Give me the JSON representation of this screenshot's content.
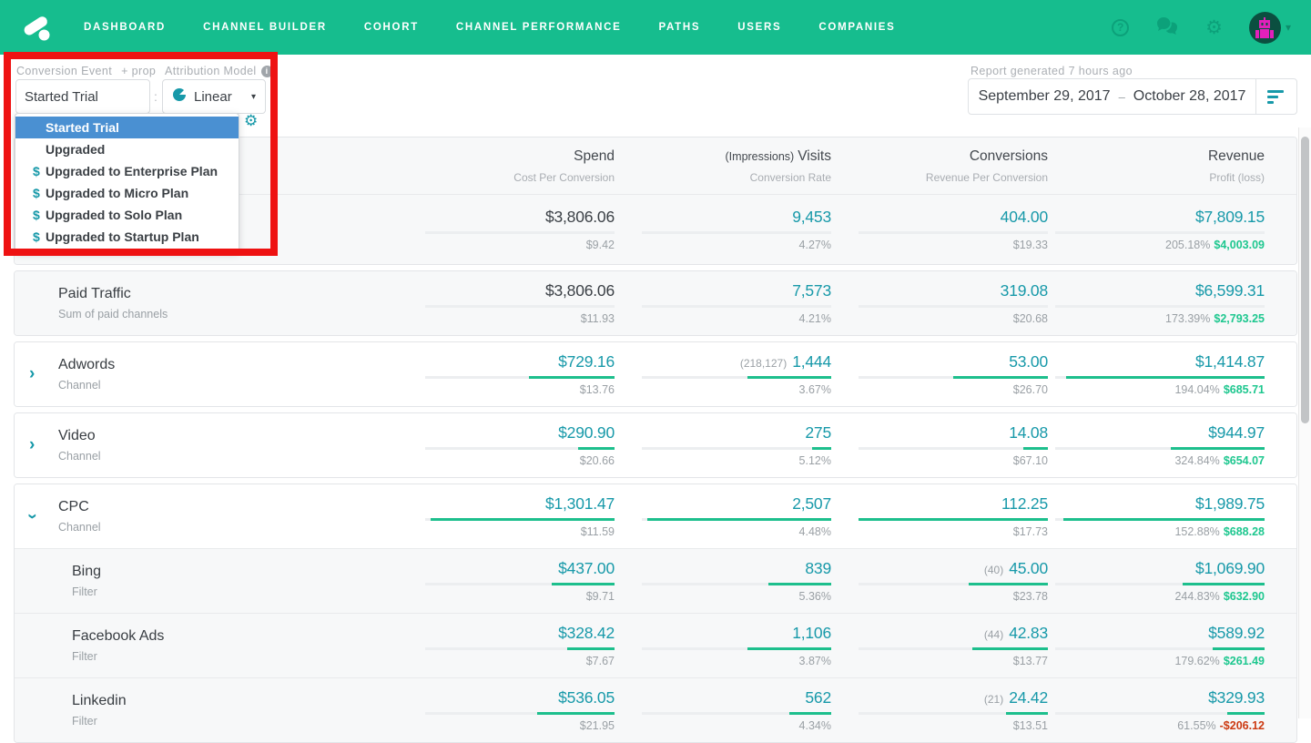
{
  "nav": {
    "items": [
      {
        "label": "DASHBOARD"
      },
      {
        "label": "CHANNEL BUILDER"
      },
      {
        "label": "COHORT"
      },
      {
        "label": "CHANNEL PERFORMANCE"
      },
      {
        "label": "PATHS"
      },
      {
        "label": "USERS"
      },
      {
        "label": "COMPANIES"
      }
    ]
  },
  "icons": {
    "help": "?",
    "gear": "⚙",
    "user_caret": "▾",
    "select_caret": "▾",
    "chevron": "›",
    "dollar": "$",
    "info": "i",
    "chat": "chat-bubbles",
    "pie": "pie-chart",
    "filter": "filter-lines",
    "logo": "attribution-logo"
  },
  "controls": {
    "conversion_event_label": "Conversion Event",
    "add_prop_label": "+ prop",
    "conversion_event_value": "Started Trial",
    "colon": ":",
    "attribution_model_label": "Attribution Model",
    "attribution_model_value": "Linear",
    "dropdown": {
      "options": [
        {
          "label": "Started Trial",
          "selected": true,
          "dollar": false
        },
        {
          "label": "Upgraded",
          "selected": false,
          "dollar": false
        },
        {
          "label": "Upgraded to Enterprise Plan",
          "selected": false,
          "dollar": true
        },
        {
          "label": "Upgraded to Micro Plan",
          "selected": false,
          "dollar": true
        },
        {
          "label": "Upgraded to Solo Plan",
          "selected": false,
          "dollar": true
        },
        {
          "label": "Upgraded to Startup Plan",
          "selected": false,
          "dollar": true
        }
      ]
    }
  },
  "report": {
    "generated_label": "Report generated 7 hours ago",
    "date_start": "September 29, 2017",
    "date_separator": "–",
    "date_end": "October 28, 2017"
  },
  "table": {
    "columns": [
      {
        "title": "Spend",
        "sub": "Cost Per Conversion"
      },
      {
        "pre": "(Impressions)",
        "title": "Visits",
        "sub": "Conversion Rate"
      },
      {
        "title": "Conversions",
        "sub": "Revenue Per Conversion"
      },
      {
        "title": "Revenue",
        "sub": "Profit (loss)"
      }
    ],
    "rows": [
      {
        "name": "",
        "type": "",
        "spend": {
          "v": "$3,806.06",
          "s": "$9.42",
          "fill": 0
        },
        "visits": {
          "pre": "",
          "v": "9,453",
          "s": "4.27%",
          "fill": 0
        },
        "conversions": {
          "pre": "",
          "v": "404.00",
          "s": "$19.33",
          "fill": 0
        },
        "revenue": {
          "v": "$7,809.15",
          "pct": "205.18%",
          "profit": "$4,003.09",
          "fill": 0
        }
      },
      {
        "name": "Paid Traffic",
        "type": "Sum of paid channels",
        "spend": {
          "v": "$3,806.06",
          "s": "$11.93",
          "fill": 0
        },
        "visits": {
          "pre": "",
          "v": "7,573",
          "s": "4.21%",
          "fill": 0
        },
        "conversions": {
          "pre": "",
          "v": "319.08",
          "s": "$20.68",
          "fill": 0
        },
        "revenue": {
          "v": "$6,599.31",
          "pct": "173.39%",
          "profit": "$2,793.25",
          "fill": 0
        }
      },
      {
        "name": "Adwords",
        "type": "Channel",
        "spend": {
          "v": "$729.16",
          "s": "$13.76",
          "fill": 45
        },
        "visits": {
          "pre": "(218,127)",
          "v": "1,444",
          "s": "3.67%",
          "fill": 44
        },
        "conversions": {
          "pre": "",
          "v": "53.00",
          "s": "$26.70",
          "fill": 50
        },
        "revenue": {
          "v": "$1,414.87",
          "pct": "194.04%",
          "profit": "$685.71",
          "fill": 95
        }
      },
      {
        "name": "Video",
        "type": "Channel",
        "spend": {
          "v": "$290.90",
          "s": "$20.66",
          "fill": 19
        },
        "visits": {
          "pre": "",
          "v": "275",
          "s": "5.12%",
          "fill": 10
        },
        "conversions": {
          "pre": "",
          "v": "14.08",
          "s": "$67.10",
          "fill": 13
        },
        "revenue": {
          "v": "$944.97",
          "pct": "324.84%",
          "profit": "$654.07",
          "fill": 45
        }
      },
      {
        "name": "CPC",
        "type": "Channel",
        "spend": {
          "v": "$1,301.47",
          "s": "$11.59",
          "fill": 97
        },
        "visits": {
          "pre": "",
          "v": "2,507",
          "s": "4.48%",
          "fill": 97
        },
        "conversions": {
          "pre": "",
          "v": "112.25",
          "s": "$17.73",
          "fill": 100
        },
        "revenue": {
          "v": "$1,989.75",
          "pct": "152.88%",
          "profit": "$688.28",
          "fill": 96
        }
      },
      {
        "name": "Bing",
        "type": "Filter",
        "spend": {
          "v": "$437.00",
          "s": "$9.71",
          "fill": 33
        },
        "visits": {
          "pre": "",
          "v": "839",
          "s": "5.36%",
          "fill": 33
        },
        "conversions": {
          "pre": "(40)",
          "v": "45.00",
          "s": "$23.78",
          "fill": 42
        },
        "revenue": {
          "v": "$1,069.90",
          "pct": "244.83%",
          "profit": "$632.90",
          "fill": 39
        }
      },
      {
        "name": "Facebook Ads",
        "type": "Filter",
        "spend": {
          "v": "$328.42",
          "s": "$7.67",
          "fill": 25
        },
        "visits": {
          "pre": "",
          "v": "1,106",
          "s": "3.87%",
          "fill": 44
        },
        "conversions": {
          "pre": "(44)",
          "v": "42.83",
          "s": "$13.77",
          "fill": 40
        },
        "revenue": {
          "v": "$589.92",
          "pct": "179.62%",
          "profit": "$261.49",
          "fill": 25
        }
      },
      {
        "name": "Linkedin",
        "type": "Filter",
        "spend": {
          "v": "$536.05",
          "s": "$21.95",
          "fill": 41
        },
        "visits": {
          "pre": "",
          "v": "562",
          "s": "4.34%",
          "fill": 22
        },
        "conversions": {
          "pre": "(21)",
          "v": "24.42",
          "s": "$13.51",
          "fill": 22
        },
        "revenue": {
          "v": "$329.93",
          "pct": "61.55%",
          "profit": "-$206.12",
          "fill": 18
        }
      }
    ]
  },
  "colors": {
    "brand_green": "#16bd8e",
    "teal_value": "#1799a9",
    "bar_green": "#1dbf8d",
    "profit_green": "#1ec78f",
    "loss_red": "#cc3a12",
    "selected_blue": "#4a90d2",
    "annotation_red": "#ee1212"
  }
}
